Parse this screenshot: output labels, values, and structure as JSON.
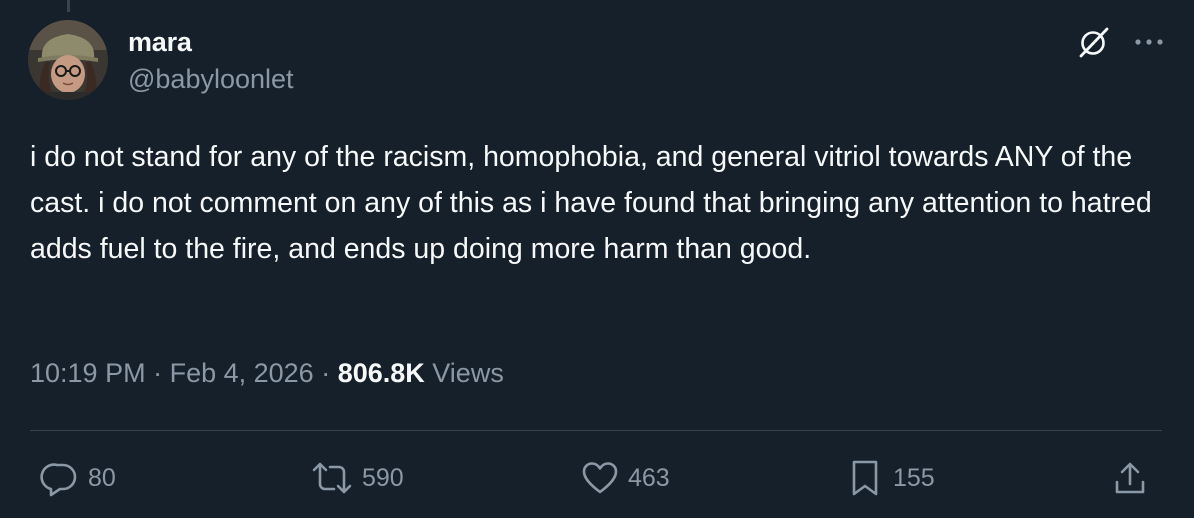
{
  "user": {
    "display_name": "mara",
    "handle": "@babyloonlet"
  },
  "tweet": {
    "text": "i do not stand for any of the racism, homophobia, and general vitriol towards ANY of the cast. i do not comment on any of this as i have found that bringing any attention to hatred adds fuel to the fire, and ends up doing more harm than good."
  },
  "meta": {
    "time": "10:19 PM",
    "separator": " · ",
    "date": "Feb 4, 2026",
    "views_count": "806.8K",
    "views_label": " Views"
  },
  "actions": {
    "reply_count": "80",
    "retweet_count": "590",
    "like_count": "463",
    "bookmark_count": "155"
  },
  "icons": {
    "top_right": [
      "grok-icon",
      "more-icon"
    ],
    "action_bar": [
      "reply-icon",
      "retweet-icon",
      "like-icon",
      "bookmark-icon",
      "share-icon"
    ]
  },
  "colors": {
    "background": "#15202b",
    "primary_text": "#f7f9f9",
    "secondary_text": "#8b98a5",
    "divider": "#38444d"
  }
}
